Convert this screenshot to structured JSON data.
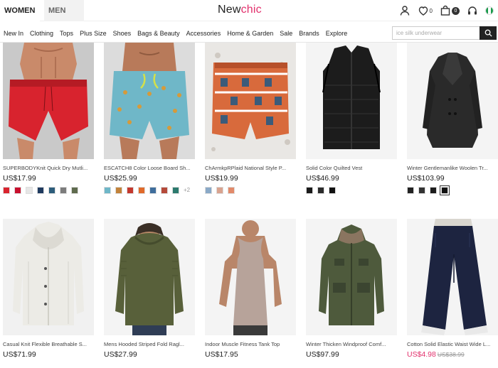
{
  "header": {
    "tabs": [
      "WOMEN",
      "MEN"
    ],
    "logo_part1": "New",
    "logo_part2": "chic",
    "wishlist_count": "0",
    "cart_count": "0",
    "icons": [
      "user-icon",
      "heart-icon",
      "cart-icon",
      "headset-icon",
      "flag-icon"
    ]
  },
  "nav": {
    "items": [
      "New In",
      "Clothing",
      "Tops",
      "Plus Size",
      "Shoes",
      "Bags & Beauty",
      "Accessories",
      "Home & Garden",
      "Sale",
      "Brands",
      "Explore"
    ]
  },
  "search": {
    "placeholder": "ice silk underwear"
  },
  "products": [
    {
      "title": "SUPERBODYKnit Quick Dry Mutli...",
      "price": "US$17.99",
      "old_price": "",
      "swatches": [
        "#d9232e",
        "#c8102e",
        "#e6e6e6",
        "#1f3a5f",
        "#2d5d7b",
        "#7c7c7c",
        "#5f6b4e"
      ],
      "more": ""
    },
    {
      "title": "ESCATCH8 Color Loose Board Sh...",
      "price": "US$25.99",
      "old_price": "",
      "swatches": [
        "#6fb7c8",
        "#c2823a",
        "#c4392e",
        "#e06a2a",
        "#3f6e9c",
        "#b54a3a",
        "#2c7a6e"
      ],
      "more": "+2"
    },
    {
      "title": "ChArmkpRPlaid National Style P...",
      "price": "US$19.99",
      "old_price": "",
      "swatches": [
        "#8aa9c7",
        "#d9a38f",
        "#e28a6a"
      ],
      "more": ""
    },
    {
      "title": "Solid Color Quilted Vest",
      "price": "US$46.99",
      "old_price": "",
      "swatches": [
        "#1a1a1a",
        "#2b2b2b",
        "#111111"
      ],
      "more": ""
    },
    {
      "title": "Winter Gentlemanlike Woolen Tr...",
      "price": "US$103.99",
      "old_price": "",
      "swatches": [
        "#222222",
        "#333333",
        "#1c1c1c",
        "#111111"
      ],
      "more": ""
    },
    {
      "title": "Casual Knit Flexible Breathable S...",
      "price": "US$71.99",
      "old_price": "",
      "swatches": [],
      "more": ""
    },
    {
      "title": "Mens Hooded Striped Fold Ragl...",
      "price": "US$27.99",
      "old_price": "",
      "swatches": [],
      "more": ""
    },
    {
      "title": "Indoor Muscle Fitness Tank Top",
      "price": "US$17.95",
      "old_price": "",
      "swatches": [],
      "more": ""
    },
    {
      "title": "Winter Thicken Windproof Comf...",
      "price": "US$97.99",
      "old_price": "",
      "swatches": [],
      "more": ""
    },
    {
      "title": "Cotton Solid Elastic Waist Wide L...",
      "price": "US$4.98",
      "old_price": "US$38.99",
      "swatches": [],
      "more": ""
    }
  ],
  "colors": {
    "brand_pink": "#e2306c",
    "dark": "#222222",
    "border": "#e6e6e6"
  }
}
